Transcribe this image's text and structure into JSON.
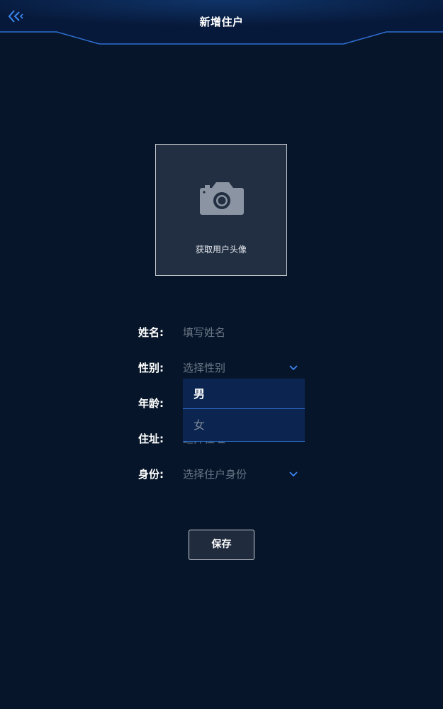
{
  "header": {
    "title": "新增住户",
    "back_icon": "double-chevron-left-icon"
  },
  "avatar": {
    "label": "获取用户头像",
    "icon": "camera-icon"
  },
  "form": {
    "name": {
      "label": "姓名:",
      "placeholder": "填写姓名"
    },
    "gender": {
      "label": "性别:",
      "placeholder": "选择性别"
    },
    "age": {
      "label": "年龄:"
    },
    "address": {
      "label": "住址:",
      "placeholder": "选择住址"
    },
    "identity": {
      "label": "身份:",
      "placeholder": "选择住户身份"
    }
  },
  "gender_dropdown": {
    "options": [
      "男",
      "女"
    ],
    "highlighted": "男"
  },
  "save_button": {
    "label": "保存"
  },
  "colors": {
    "background": "#061529",
    "header_line": "#2f6fd1",
    "accent": "#3b86f0",
    "dropdown_bg": "#0b2550",
    "placeholder": "#6b7787"
  }
}
